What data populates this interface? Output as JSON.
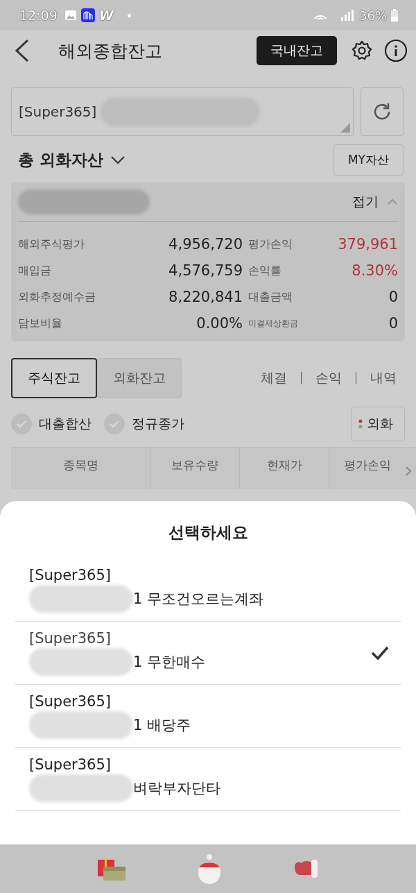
{
  "status_bar": {
    "time": "12:09",
    "app_letter": "W",
    "battery": "36%"
  },
  "header": {
    "title": "해외종합잔고",
    "domestic_button": "국내잔고"
  },
  "account": {
    "prefix": "[Super365]"
  },
  "assets": {
    "title": "총 외화자산",
    "my_button": "MY자산",
    "collapse": "접기",
    "rows": [
      {
        "label": "해외주식평가",
        "value": "4,956,720",
        "label2": "평가손익",
        "value2": "379,961",
        "highlight": true,
        "small_label": false
      },
      {
        "label": "매입금",
        "value": "4,576,759",
        "label2": "손익률",
        "value2": "8.30%",
        "highlight": true,
        "small_label": false
      },
      {
        "label": "외화추정예수금",
        "value": "8,220,841",
        "label2": "대출금액",
        "value2": "0",
        "highlight": false,
        "small_label": false
      },
      {
        "label": "담보비율",
        "value": "0.00%",
        "label2": "미결제상환금",
        "value2": "0",
        "highlight": false,
        "small_label": true
      }
    ]
  },
  "tabs": [
    {
      "label": "주식잔고",
      "selected": true
    },
    {
      "label": "외화잔고",
      "selected": false
    }
  ],
  "links": [
    "체결",
    "손익",
    "내역"
  ],
  "filters": [
    {
      "label": "대출합산",
      "checked": false
    },
    {
      "label": "정규종가",
      "checked": false
    }
  ],
  "currency_button": "외화",
  "table": {
    "columns": [
      "종목명",
      "보유수량",
      "현재가",
      "평가손익"
    ]
  },
  "sheet": {
    "title": "선택하세요",
    "accounts": [
      {
        "prefix": "[Super365]",
        "name": "1 무조건오르는계좌",
        "selected": false
      },
      {
        "prefix": "[Super365]",
        "name": "1 무한매수",
        "selected": true
      },
      {
        "prefix": "[Super365]",
        "name": "1 배당주",
        "selected": false
      },
      {
        "prefix": "[Super365]",
        "name": "벼락부자단타",
        "selected": false
      }
    ]
  }
}
